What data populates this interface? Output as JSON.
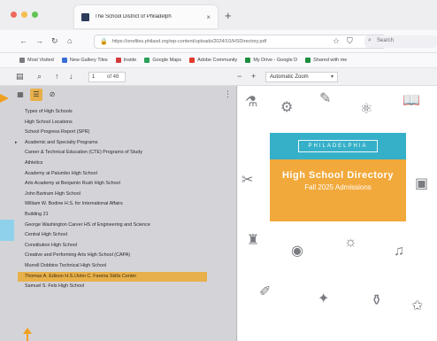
{
  "window": {
    "tab_title": "The School District of Philadelph",
    "tab_close": "×",
    "new_tab": "+"
  },
  "nav": {
    "url": "https://onefiles.philasd.org/wp-content/uploads/2024/10/HSDirectory.pdf",
    "url_domain": "philasd.org",
    "search_placeholder": "Search"
  },
  "bookmarks": [
    {
      "label": "Most Visited",
      "color": "#7a7a80"
    },
    {
      "label": "New Gallery Tiles",
      "color": "#3b6fd6"
    },
    {
      "label": "Inside",
      "color": "#d33b3b"
    },
    {
      "label": "Google Maps",
      "color": "#2aa05a"
    },
    {
      "label": "Adobe Community",
      "color": "#e03a2a"
    },
    {
      "label": "My Drive - Google D",
      "color": "#1e8e3e"
    },
    {
      "label": "Shared with me",
      "color": "#1e8e3e"
    }
  ],
  "pdf_toolbar": {
    "page_value": "1",
    "page_of": "of 48",
    "zoom_value": "Automatic Zoom"
  },
  "sidebar": {
    "outline": [
      {
        "label": "Types of High Schools",
        "expandable": false
      },
      {
        "label": "High School Locations",
        "expandable": false
      },
      {
        "label": "School Progress Report (SPR)",
        "expandable": false
      },
      {
        "label": "Academic and Specialty Programs",
        "expandable": true
      },
      {
        "label": "Career & Technical Education (CTE) Programs of Study",
        "expandable": false
      },
      {
        "label": "Athletics",
        "expandable": false
      },
      {
        "label": "Academy at Palumbo High School",
        "expandable": false
      },
      {
        "label": "Arts Academy at Benjamin Rush High School",
        "expandable": false
      },
      {
        "label": "John Bartram High School",
        "expandable": false
      },
      {
        "label": "William W. Bodine H.S. for International Affairs",
        "expandable": false
      },
      {
        "label": "Building 21",
        "expandable": false
      },
      {
        "label": "George Washington Carver HS of Engineering and Science",
        "expandable": false
      },
      {
        "label": "Central High School",
        "expandable": false
      },
      {
        "label": "Constitution High School",
        "expandable": false
      },
      {
        "label": "Creative and Performing Arts High School (CAPA)",
        "expandable": false
      },
      {
        "label": "Murrell Dobbins Technical High School",
        "expandable": false
      },
      {
        "label": "Thomas A. Edison H.S./John C. Fareira Skills Center",
        "expandable": false,
        "selected": true
      },
      {
        "label": "Samuel S. Fels High School",
        "expandable": false
      }
    ]
  },
  "cover": {
    "brand": "PHILADELPHIA",
    "title": "High School Directory",
    "subtitle": "Fall 2025 Admissions",
    "teal": "#36b0c9",
    "orange": "#f2a93b"
  },
  "colors": {
    "selection": "#e8b04a",
    "annotation_orange": "#f0a020",
    "annotation_blue": "#8fd1ea"
  }
}
